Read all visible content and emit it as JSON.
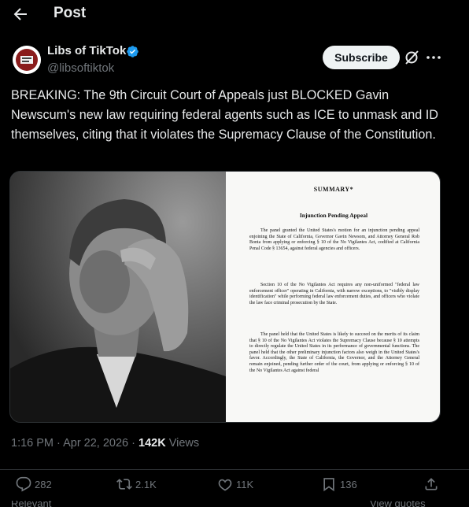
{
  "header": {
    "title": "Post",
    "back_icon": "arrow-left-icon"
  },
  "author": {
    "display_name": "Libs of TikTok",
    "handle": "@libsoftiktok",
    "verified": true,
    "avatar_text": "Libs of TikTok",
    "subscribe_label": "Subscribe"
  },
  "post": {
    "text": "BREAKING: The 9th Circuit Court of Appeals just BLOCKED Gavin Newscum's new law requiring federal agents such as ICE to unmask and ID themselves, citing that it violates the Supremacy Clause of the Constitution."
  },
  "document": {
    "title": "SUMMARY*",
    "subtitle": "Injunction Pending Appeal",
    "paragraphs": [
      "The panel granted the United States's motion for an injunction pending appeal enjoining the State of California, Governor Gavin Newsom, and Attorney General Rob Bonta from applying or enforcing § 10 of the No Vigilantes Act, codified at California Penal Code § 13654, against federal agencies and officers.",
      "Section 10 of the No Vigilantes Act requires any non-uniformed \"federal law enforcement officer\" operating in California, with narrow exceptions, to \"visibly display identification\" while performing federal law enforcement duties, and officers who violate the law face criminal prosecution by the State.",
      "The panel held that the United States is likely to succeed on the merits of its claim that § 10 of the No Vigilantes Act violates the Supremacy Clause because § 10 attempts to directly regulate the United States in its performance of governmental functions. The panel held that the other preliminary injunction factors also weigh in the United States's favor. Accordingly, the State of California, the Governor, and the Attorney General remain enjoined, pending further order of the court, from applying or enforcing § 10 of the No Vigilantes Act against federal"
    ]
  },
  "meta": {
    "time": "1:16 PM · Apr 22, 2026 · ",
    "views_count": "142K",
    "views_label": " Views"
  },
  "actions": {
    "replies": "282",
    "reposts": "2.1K",
    "likes": "11K",
    "bookmarks": "136"
  },
  "footer": {
    "left": "Relevant",
    "right": "View quotes"
  },
  "colors": {
    "background": "#000000",
    "text": "#e7e9ea",
    "muted": "#71767b",
    "verified": "#1d9bf0"
  }
}
